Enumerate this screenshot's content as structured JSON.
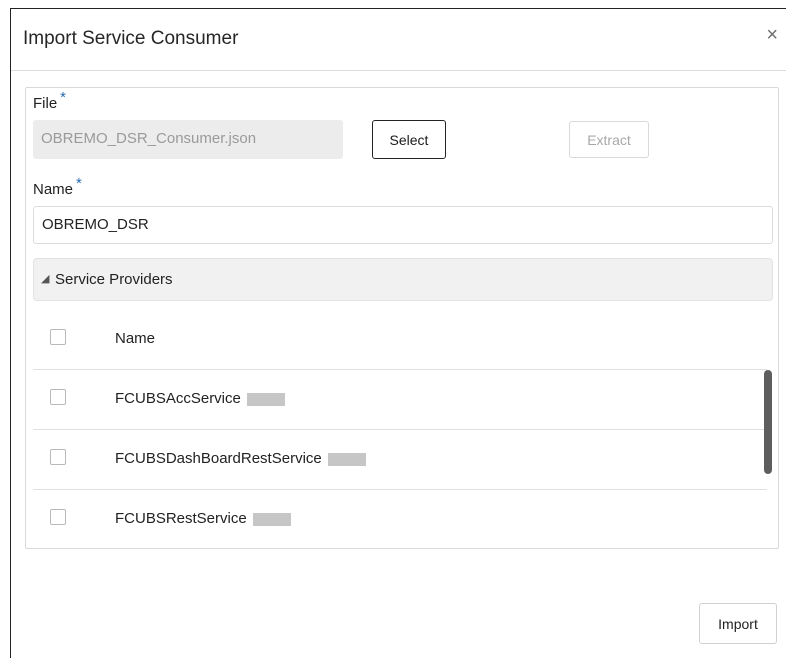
{
  "dialog": {
    "title": "Import Service Consumer",
    "close_label": "×"
  },
  "form": {
    "file_label": "File",
    "file_required": "*",
    "file_value": "OBREMO_DSR_Consumer.json",
    "select_label": "Select",
    "extract_label": "Extract",
    "name_label": "Name",
    "name_required": "*",
    "name_value": "OBREMO_DSR"
  },
  "providers": {
    "section_title": "Service Providers",
    "column_name": "Name",
    "rows": [
      {
        "name": "FCUBSAccService"
      },
      {
        "name": "FCUBSDashBoardRestService"
      },
      {
        "name": "FCUBSRestService"
      }
    ]
  },
  "footer": {
    "import_label": "Import"
  }
}
